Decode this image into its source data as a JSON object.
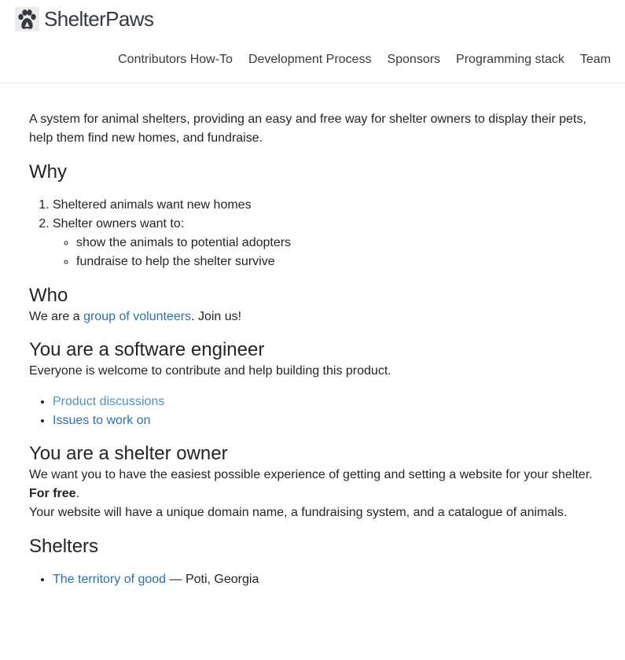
{
  "header": {
    "brand_name": "ShelterPaws",
    "logo_icon": "paw-icon",
    "nav": [
      "Contributors How-To",
      "Development Process",
      "Sponsors",
      "Programming stack",
      "Team"
    ]
  },
  "main": {
    "intro": "A system for animal shelters, providing an easy and free way for shelter owners to display their pets, help them find new homes, and fundraise.",
    "why": {
      "title": "Why",
      "items": [
        "Sheltered animals want new homes",
        "Shelter owners want to:"
      ],
      "subitems": [
        "show the animals to potential adopters",
        "fundraise to help the shelter survive"
      ]
    },
    "who": {
      "title": "Who",
      "text_before": "We are a ",
      "link": "group of volunteers",
      "text_after": ". Join us!"
    },
    "engineer": {
      "title": "You are a software engineer",
      "text": "Everyone is welcome to contribute and help building this product.",
      "links": [
        "Product discussions",
        "Issues to work on"
      ]
    },
    "owner": {
      "title": "You are a shelter owner",
      "text": "We want you to have the easiest possible experience of getting and setting a website for your shelter. ",
      "bold": "For free",
      "bold_after": ".",
      "text2": "Your website will have a unique domain name, a fundraising system, and a catalogue of animals."
    },
    "shelters": {
      "title": "Shelters",
      "items": [
        {
          "link": "The territory of good",
          "location": " — Poti, Georgia"
        }
      ]
    }
  },
  "colors": {
    "link": "#2c6fad",
    "link_light": "#4a90c8",
    "text": "#212529"
  }
}
